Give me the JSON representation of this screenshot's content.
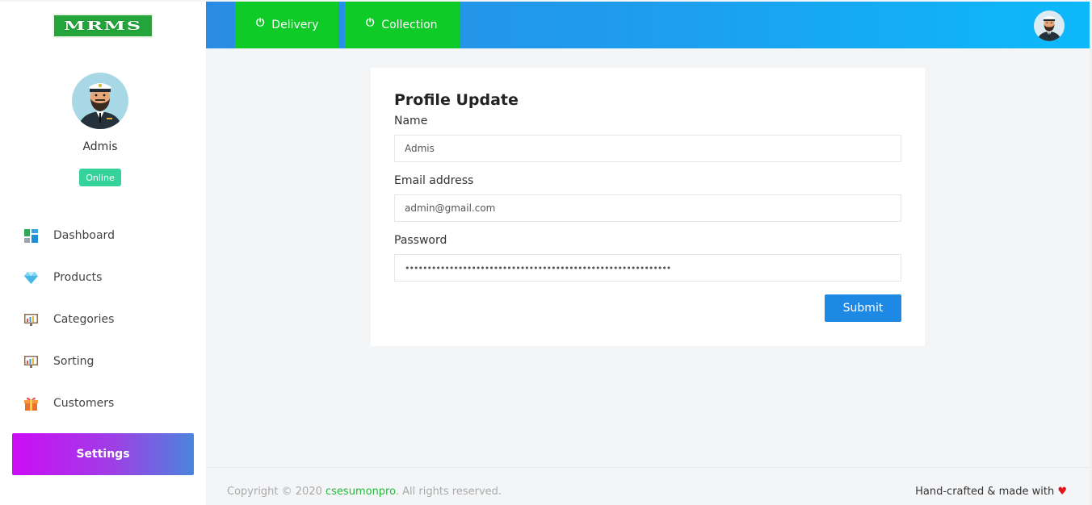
{
  "brand": {
    "logo_text": "MRMS"
  },
  "profile": {
    "name": "Admis",
    "status": "Online"
  },
  "sidebar": {
    "items": [
      {
        "label": "Dashboard",
        "icon": "dashboard-icon"
      },
      {
        "label": "Products",
        "icon": "diamond-icon"
      },
      {
        "label": "Categories",
        "icon": "chart-board-icon"
      },
      {
        "label": "Sorting",
        "icon": "chart-board-icon"
      },
      {
        "label": "Customers",
        "icon": "gift-icon"
      }
    ],
    "settings_label": "Settings"
  },
  "topbar": {
    "tabs": [
      {
        "label": "Delivery",
        "icon": "power-icon"
      },
      {
        "label": "Collection",
        "icon": "power-icon"
      }
    ]
  },
  "form": {
    "title": "Profile Update",
    "name_label": "Name",
    "name_value": "Admis",
    "email_label": "Email address",
    "email_value": "admin@gmail.com",
    "password_label": "Password",
    "password_value": "••••••••••••••••••••••••••••••••••••••••••••••••••••••••••••",
    "submit_label": "Submit"
  },
  "footer": {
    "copyright_prefix": "Copyright © 2020 ",
    "copyright_brand": "csesumonpro",
    "copyright_suffix": ". All rights reserved.",
    "made_with": "Hand-crafted & made with "
  },
  "colors": {
    "accent_blue": "#1e88e5",
    "tab_green": "#0ecb27",
    "online_green": "#35d39b",
    "settings_gradient_start": "#cc0cf5",
    "settings_gradient_end": "#4a85dc"
  }
}
